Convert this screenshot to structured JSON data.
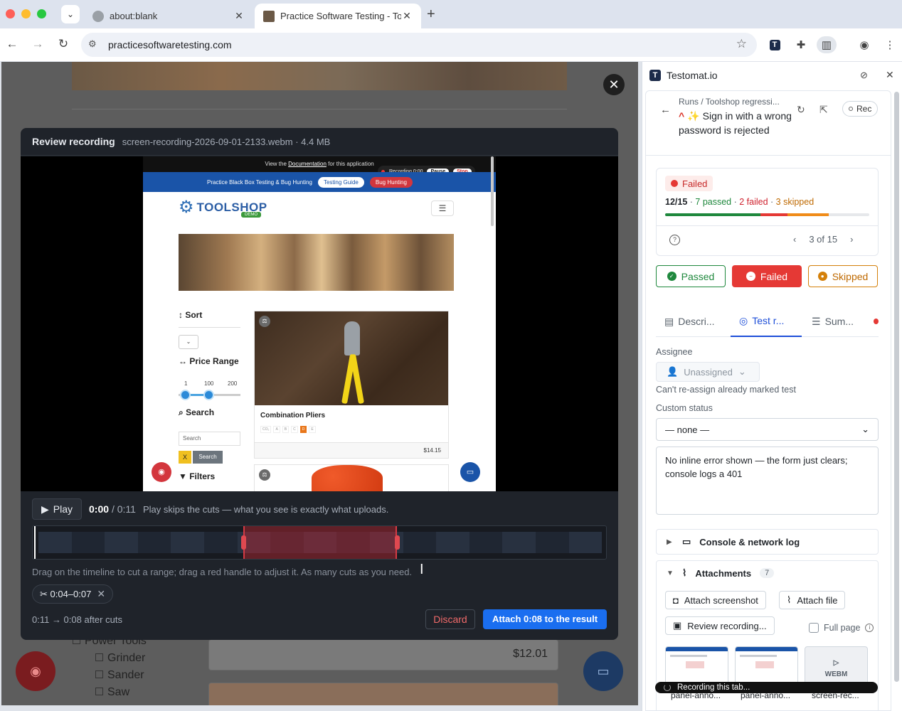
{
  "browser": {
    "tabs": [
      {
        "title": "about:blank"
      },
      {
        "title": "Practice Software Testing - To"
      }
    ],
    "url": "practicesoftwaretesting.com",
    "icons": [
      "back-icon",
      "forward-icon",
      "reload-icon",
      "site-settings-icon",
      "bookmark-star-icon",
      "testomat-extension-icon",
      "extensions-puzzle-icon",
      "side-panel-icon",
      "profile-icon",
      "menu-kebab-icon"
    ]
  },
  "page": {
    "categories": [
      "Power Tools",
      "Grinder",
      "Sander",
      "Saw"
    ],
    "card_price": "$12.01"
  },
  "modal": {
    "title": "Review recording",
    "file": "screen-recording-2026-09-01-2133.webm · 4.4 MB",
    "frame": {
      "doc_prefix": "View the ",
      "doc_link": "Documentation",
      "doc_suffix": " for this application",
      "rec_time": "Recording 0:00",
      "pause": "Pause",
      "stop": "Stop",
      "banner_text": "Practice Black Box Testing & Bug Hunting",
      "testing_guide": "Testing Guide",
      "bug_hunting": "Bug Hunting",
      "logo": "TOOLSHOP",
      "logo_badge": "DEMO",
      "sort": "Sort",
      "price_range": "Price Range",
      "ticks": [
        "1",
        "100",
        "200"
      ],
      "search_heading": "Search",
      "search_placeholder": "Search",
      "x_label": "X",
      "search_btn": "Search",
      "filters": "Filters",
      "product_name": "Combination Pliers",
      "product_price": "$14.15",
      "badges": [
        "CO₂",
        "A",
        "B",
        "C",
        "D",
        "E"
      ]
    },
    "play_label": "Play",
    "time_current": "0:00",
    "time_total": "/ 0:11",
    "play_hint": "Play skips the cuts — what you see is exactly what uploads.",
    "timeline": {
      "duration_s": 11,
      "cut_start_s": 4,
      "cut_end_s": 7
    },
    "drag_hint": "Drag on the timeline to cut a range; drag a red handle to adjust it. As many cuts as you need.",
    "cut_chip": "✂ 0:04–0:07",
    "after_cuts": "0:11 → 0:08 after cuts",
    "discard": "Discard",
    "attach": "Attach 0:08 to the result"
  },
  "panel": {
    "app_name": "Testomat.io",
    "breadcrumb": "Runs / Toolshop regressi...",
    "test_title": "Sign in with a wrong password is rejected",
    "rec_label": "Rec",
    "status": "Failed",
    "stats": {
      "progress": "12/15",
      "passed": "7 passed",
      "failed": "2 failed",
      "skipped": "3 skipped",
      "passed_n": 7,
      "failed_n": 2,
      "skipped_n": 3,
      "total_n": 15
    },
    "pager": "3 of 15",
    "buttons": {
      "passed": "Passed",
      "failed": "Failed",
      "skipped": "Skipped"
    },
    "tabs": [
      "Descri...",
      "Test r...",
      "Sum..."
    ],
    "assignee_label": "Assignee",
    "assignee_value": "Unassigned",
    "assignee_note": "Can't re-assign already marked test",
    "custom_status_label": "Custom status",
    "custom_status_value": "— none —",
    "note": "No inline error shown — the form just clears; console logs a 401",
    "console_log": "Console & network log",
    "attachments": "Attachments",
    "attachments_count": "7",
    "attach_screenshot": "Attach screenshot",
    "attach_file": "Attach file",
    "review_recording": "Review recording...",
    "full_page": "Full page",
    "thumbs": [
      "panel-anno...",
      "panel-anno...",
      "screen-rec..."
    ],
    "webm": "WEBM",
    "recording_bar": "Recording this tab..."
  },
  "colors": {
    "accent": "#1a6ef0",
    "passed": "#1f883d",
    "failed": "#e53935",
    "skipped": "#f08c1a",
    "cut": "#d43a44"
  }
}
